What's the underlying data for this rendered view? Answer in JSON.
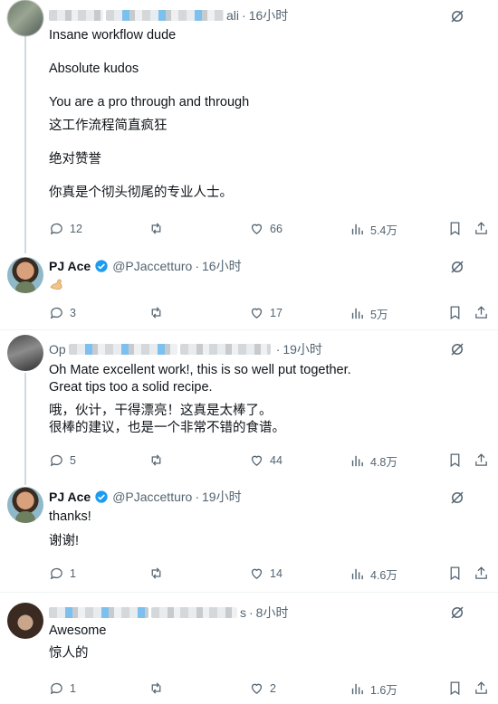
{
  "ui": {
    "accent": "#1d9bf0",
    "text": "#0f1419",
    "muted": "#536471"
  },
  "tweets": [
    {
      "name_suffix": "ali",
      "time": "16小时",
      "lines": [
        "Insane workflow dude",
        "Absolute kudos",
        "You are a pro through and through",
        "这工作流程简直疯狂",
        "绝对赞誉",
        "你真是个彻头彻尾的专业人士。"
      ],
      "replies": "12",
      "reposts": "",
      "likes": "66",
      "views": "5.4万"
    },
    {
      "name": "PJ Ace",
      "handle": "@PJaccetturo",
      "time": "16小时",
      "emoji": "flexed-biceps",
      "replies": "3",
      "reposts": "",
      "likes": "17",
      "views": "5万"
    },
    {
      "name_prefix": "Op",
      "time": "19小时",
      "lines": [
        "Oh Mate excellent work!, this is so well put together.",
        "Great tips too a solid recipe.",
        "哦，伙计，干得漂亮！这真是太棒了。",
        "很棒的建议，也是一个非常不错的食谱。"
      ],
      "replies": "5",
      "reposts": "",
      "likes": "44",
      "views": "4.8万"
    },
    {
      "name": "PJ Ace",
      "handle": "@PJaccetturo",
      "time": "19小时",
      "lines": [
        "thanks!",
        "谢谢!"
      ],
      "replies": "1",
      "reposts": "",
      "likes": "14",
      "views": "4.6万"
    },
    {
      "name_suffix": "s",
      "time": "8小时",
      "lines": [
        "Awesome",
        "惊人的"
      ],
      "replies": "1",
      "reposts": "",
      "likes": "2",
      "views": "1.6万"
    }
  ],
  "dot": "·"
}
